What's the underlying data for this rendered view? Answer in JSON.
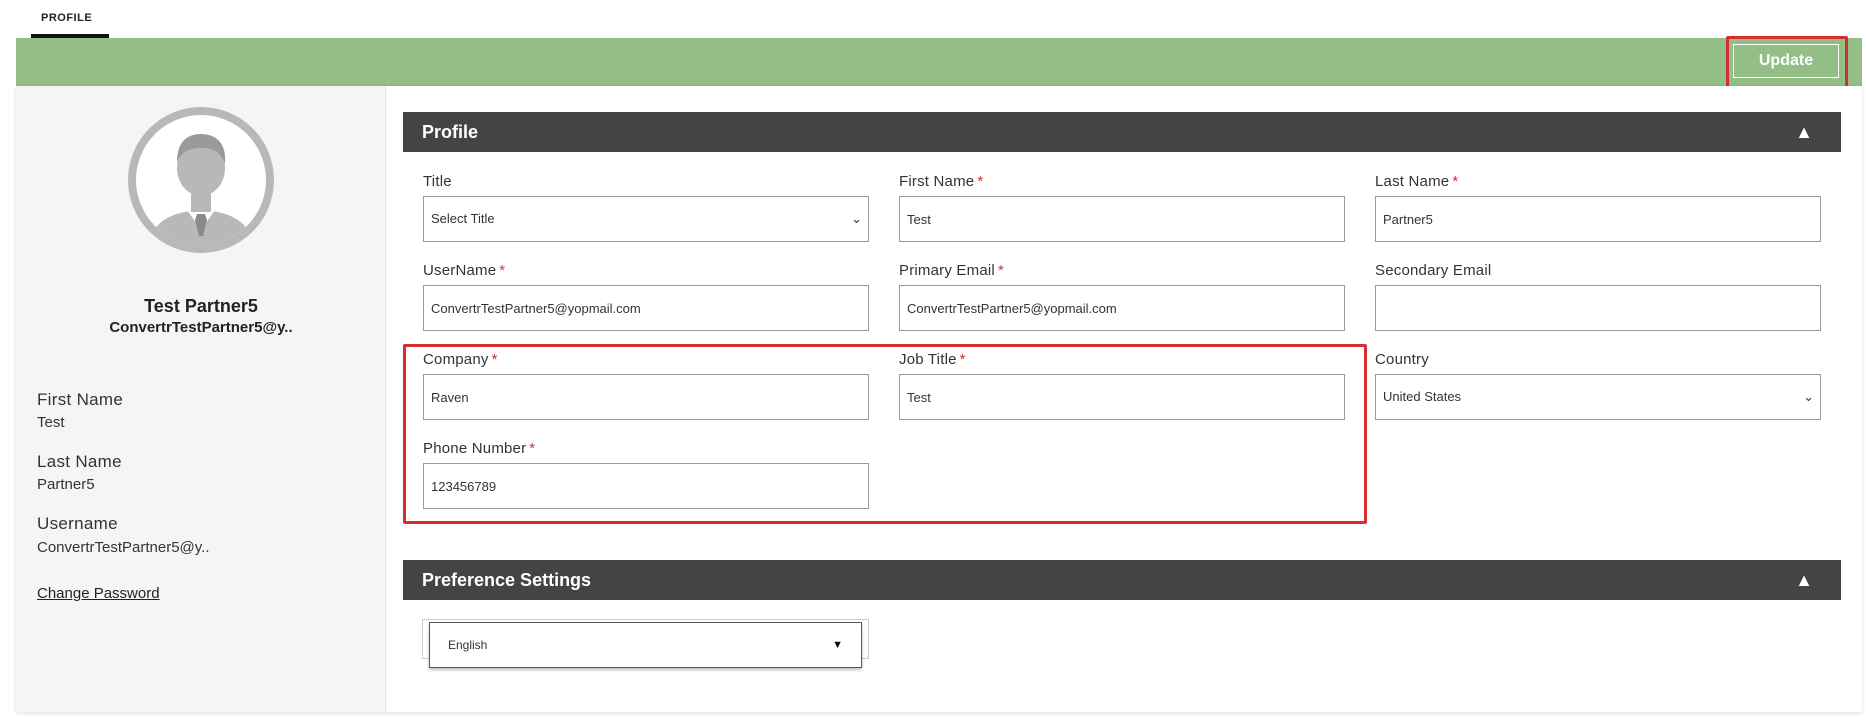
{
  "tab": {
    "label": "PROFILE"
  },
  "toolbar": {
    "update_label": "Update"
  },
  "sidebar": {
    "display_name": "Test Partner5",
    "display_email": "ConvertrTestPartner5@y..",
    "first_name_label": "First Name",
    "first_name_value": "Test",
    "last_name_label": "Last Name",
    "last_name_value": "Partner5",
    "username_label": "Username",
    "username_value": "ConvertrTestPartner5@y..",
    "change_password_label": "Change Password"
  },
  "profile_section": {
    "title": "Profile",
    "fields": {
      "title": {
        "label": "Title",
        "value": "Select Title"
      },
      "first_name": {
        "label": "First Name",
        "value": "Test"
      },
      "last_name": {
        "label": "Last Name",
        "value": "Partner5"
      },
      "username": {
        "label": "UserName",
        "value": "ConvertrTestPartner5@yopmail.com"
      },
      "primary_email": {
        "label": "Primary Email",
        "value": "ConvertrTestPartner5@yopmail.com"
      },
      "secondary_email": {
        "label": "Secondary Email",
        "value": ""
      },
      "company": {
        "label": "Company",
        "value": "Raven"
      },
      "job_title": {
        "label": "Job Title",
        "value": "Test"
      },
      "country": {
        "label": "Country",
        "value": "United States"
      },
      "phone": {
        "label": "Phone Number",
        "value": "123456789"
      }
    }
  },
  "preference_section": {
    "title": "Preference Settings",
    "language": {
      "value": "English"
    }
  },
  "colors": {
    "green_bar": "#93bf87",
    "section_header": "#434445",
    "highlight": "#d62d2d",
    "required": "#d62d2d"
  }
}
